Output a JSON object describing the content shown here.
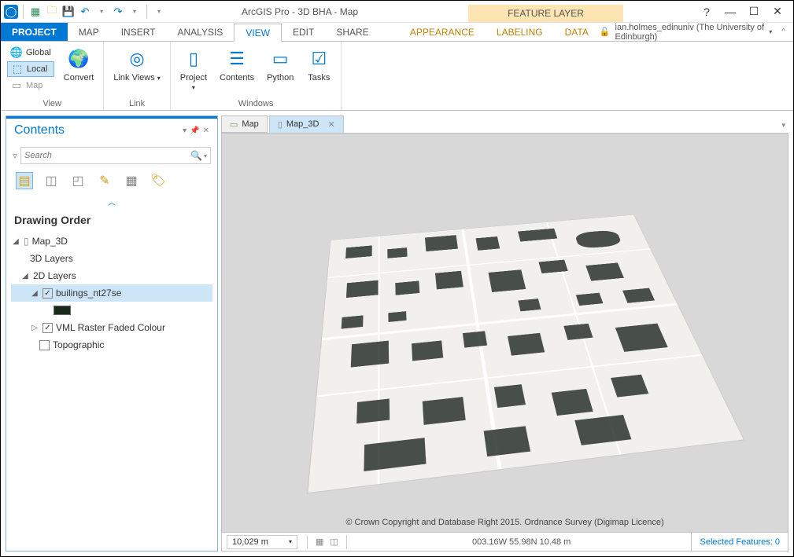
{
  "title": "ArcGIS Pro - 3D BHA - Map",
  "context_tab": "FEATURE LAYER",
  "user": "ian.holmes_edinuniv (The University of Edinburgh)",
  "ribbon_tabs": {
    "project": "PROJECT",
    "map": "MAP",
    "insert": "INSERT",
    "analysis": "ANALYSIS",
    "view": "VIEW",
    "edit": "EDIT",
    "share": "SHARE",
    "appearance": "APPEARANCE",
    "labeling": "LABELING",
    "data": "DATA"
  },
  "ribbon": {
    "view_group": "View",
    "link_group": "Link",
    "windows_group": "Windows",
    "global": "Global",
    "local": "Local",
    "map": "Map",
    "convert": "Convert",
    "link_views": "Link Views",
    "project": "Project",
    "contents": "Contents",
    "python": "Python",
    "tasks": "Tasks"
  },
  "contents": {
    "title": "Contents",
    "search_placeholder": "Search",
    "section": "Drawing Order",
    "map_name": "Map_3D",
    "layers3d": "3D Layers",
    "layers2d": "2D Layers",
    "layer_buildings": "builings_nt27se",
    "layer_vml": "VML Raster Faded Colour",
    "layer_topo": "Topographic"
  },
  "maptabs": {
    "map": "Map",
    "map3d": "Map_3D"
  },
  "attribution": "© Crown Copyright and Database Right 2015. Ordnance Survey (Digimap Licence)",
  "status": {
    "scale": "10,029 m",
    "coords": "003.16W 55.98N   10.48 m",
    "selected": "Selected Features: 0"
  }
}
